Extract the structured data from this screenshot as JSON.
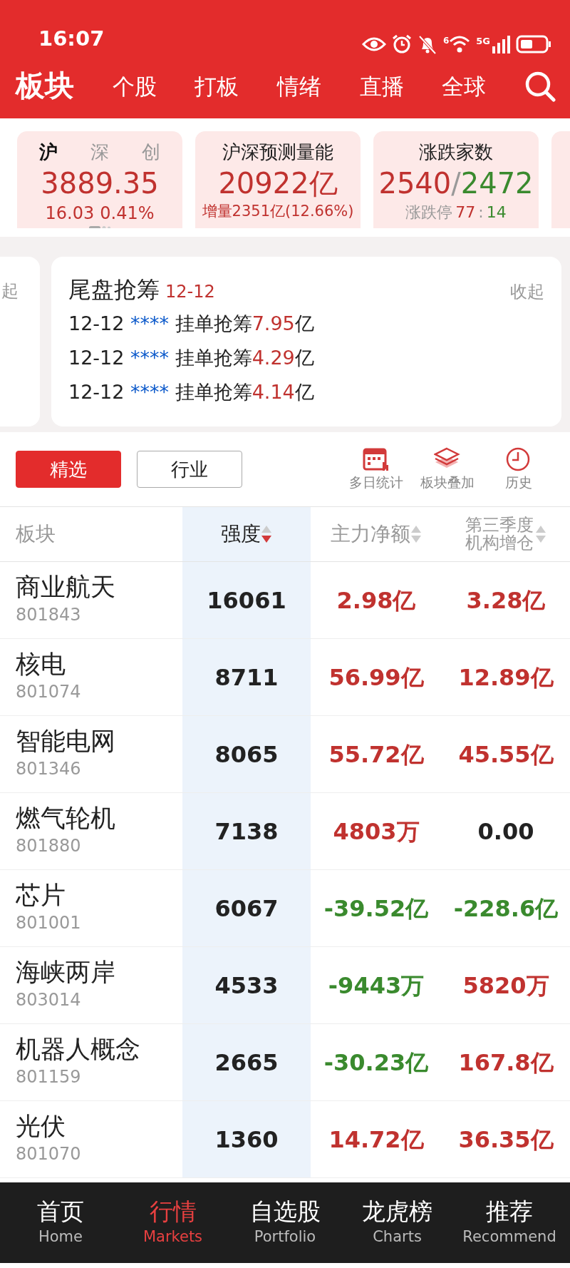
{
  "status_bar": {
    "time": "16:07",
    "wifi_label": "6",
    "network": "5G"
  },
  "header": {
    "tabs": [
      {
        "label": "板块",
        "selected": true
      },
      {
        "label": "个股",
        "selected": false
      },
      {
        "label": "打板",
        "selected": false
      },
      {
        "label": "情绪",
        "selected": false
      },
      {
        "label": "直播",
        "selected": false
      },
      {
        "label": "全球",
        "selected": false
      }
    ]
  },
  "index_card": {
    "tabs": [
      {
        "label": "沪",
        "selected": true
      },
      {
        "label": "深",
        "selected": false
      },
      {
        "label": "创",
        "selected": false
      }
    ],
    "value": "3889.35",
    "change": "16.03",
    "percent": "0.41%"
  },
  "volume_card": {
    "title": "沪深预测量能",
    "value": "20922亿",
    "note": "增量2351亿(12.66%)"
  },
  "breadth_card": {
    "title": "涨跌家数",
    "up": "2540",
    "separator": "/",
    "down": "2472",
    "limit_label": "涨跌停",
    "limit_up": "77",
    "limit_separator": ":",
    "limit_down": "14"
  },
  "partial_card": {
    "action": "起"
  },
  "feed": {
    "title": "尾盘抢筹",
    "date": "12-12",
    "action": "收起",
    "items": [
      {
        "date": "12-12",
        "masked": "****",
        "text": "挂单抢筹",
        "amount": "7.95",
        "unit": "亿"
      },
      {
        "date": "12-12",
        "masked": "****",
        "text": "挂单抢筹",
        "amount": "4.29",
        "unit": "亿"
      },
      {
        "date": "12-12",
        "masked": "****",
        "text": "挂单抢筹",
        "amount": "4.14",
        "unit": "亿"
      }
    ]
  },
  "segments": [
    {
      "label": "精选",
      "selected": true
    },
    {
      "label": "行业",
      "selected": false
    }
  ],
  "tools": [
    {
      "kind": "stats",
      "label": "多日统计"
    },
    {
      "kind": "layers",
      "label": "板块叠加"
    },
    {
      "kind": "history",
      "label": "历史"
    }
  ],
  "table": {
    "columns": [
      {
        "label": "板块"
      },
      {
        "label": "强度",
        "sorted": true
      },
      {
        "label": "主力净额",
        "sorted": false
      },
      {
        "label": "第三季度机构增仓",
        "sorted": false
      }
    ],
    "rows": [
      {
        "name": "商业航天",
        "code": "801843",
        "strength": "16061",
        "net": {
          "text": "2.98亿",
          "color": "#c0322f"
        },
        "inst": {
          "text": "3.28亿",
          "color": "#c0322f"
        }
      },
      {
        "name": "核电",
        "code": "801074",
        "strength": "8711",
        "net": {
          "text": "56.99亿",
          "color": "#c0322f"
        },
        "inst": {
          "text": "12.89亿",
          "color": "#c0322f"
        }
      },
      {
        "name": "智能电网",
        "code": "801346",
        "strength": "8065",
        "net": {
          "text": "55.72亿",
          "color": "#c0322f"
        },
        "inst": {
          "text": "45.55亿",
          "color": "#c0322f"
        }
      },
      {
        "name": "燃气轮机",
        "code": "801880",
        "strength": "7138",
        "net": {
          "text": "4803万",
          "color": "#c0322f"
        },
        "inst": {
          "text": "0.00",
          "color": "#222222"
        }
      },
      {
        "name": "芯片",
        "code": "801001",
        "strength": "6067",
        "net": {
          "text": "-39.52亿",
          "color": "#3a8a2e"
        },
        "inst": {
          "text": "-228.6亿",
          "color": "#3a8a2e"
        }
      },
      {
        "name": "海峡两岸",
        "code": "803014",
        "strength": "4533",
        "net": {
          "text": "-9443万",
          "color": "#3a8a2e"
        },
        "inst": {
          "text": "5820万",
          "color": "#c0322f"
        }
      },
      {
        "name": "机器人概念",
        "code": "801159",
        "strength": "2665",
        "net": {
          "text": "-30.23亿",
          "color": "#3a8a2e"
        },
        "inst": {
          "text": "167.8亿",
          "color": "#c0322f"
        }
      },
      {
        "name": "光伏",
        "code": "801070",
        "strength": "1360",
        "net": {
          "text": "14.72亿",
          "color": "#c0322f"
        },
        "inst": {
          "text": "36.35亿",
          "color": "#c0322f"
        }
      }
    ]
  },
  "bottom_nav": [
    {
      "label": "首页",
      "sub": "Home",
      "selected": false
    },
    {
      "label": "行情",
      "sub": "Markets",
      "selected": true
    },
    {
      "label": "自选股",
      "sub": "Portfolio",
      "selected": false
    },
    {
      "label": "龙虎榜",
      "sub": "Charts",
      "selected": false
    },
    {
      "label": "推荐",
      "sub": "Recommend",
      "selected": false
    }
  ]
}
